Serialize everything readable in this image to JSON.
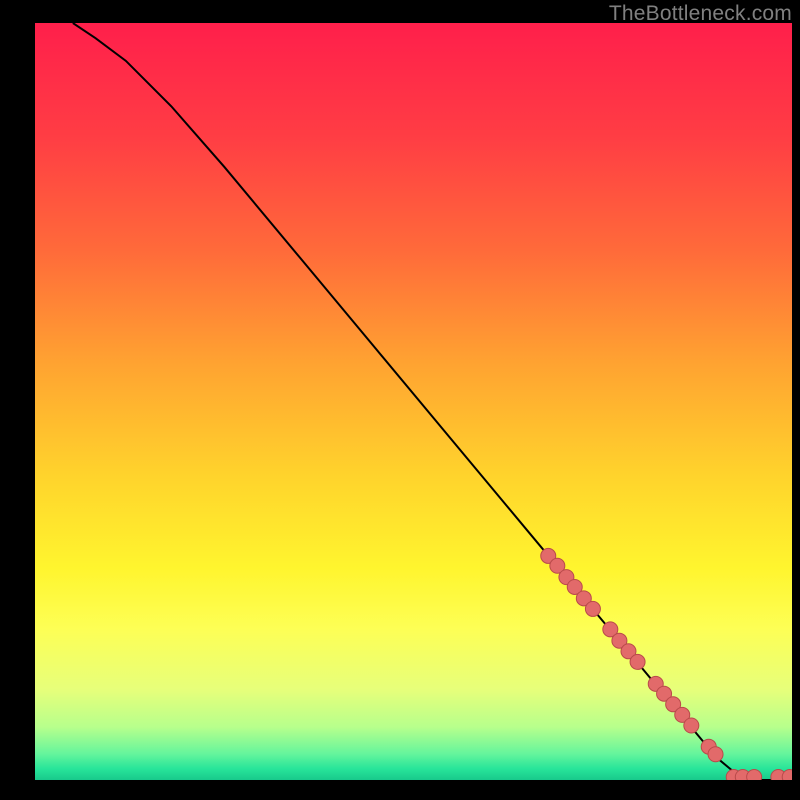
{
  "watermark": "TheBottleneck.com",
  "colors": {
    "marker_fill": "#e26a6a",
    "marker_stroke": "#b94a4a",
    "curve": "#000000",
    "black": "#000000"
  },
  "chart_data": {
    "type": "line",
    "title": "",
    "xlabel": "",
    "ylabel": "",
    "xlim": [
      0,
      100
    ],
    "ylim": [
      0,
      100
    ],
    "grid": false,
    "legend": false,
    "series": [
      {
        "name": "curve",
        "kind": "line",
        "x": [
          5,
          8,
          12,
          18,
          25,
          35,
          45,
          55,
          65,
          75,
          85,
          90,
          93,
          96,
          100
        ],
        "y": [
          100,
          98,
          95,
          89,
          81,
          69,
          57,
          45,
          33,
          21,
          9,
          3,
          0.5,
          0,
          0
        ]
      },
      {
        "name": "markers",
        "kind": "scatter",
        "x": [
          67.8,
          69.0,
          70.2,
          71.3,
          72.5,
          73.7,
          76.0,
          77.2,
          78.4,
          79.6,
          82.0,
          83.1,
          84.3,
          85.5,
          86.7,
          89.0,
          89.9,
          92.3,
          93.5,
          95.0,
          98.2,
          99.7
        ],
        "y": [
          29.6,
          28.3,
          26.8,
          25.5,
          24.0,
          22.6,
          19.9,
          18.4,
          17.0,
          15.6,
          12.7,
          11.4,
          10.0,
          8.6,
          7.2,
          4.4,
          3.4,
          0.4,
          0.4,
          0.4,
          0.4,
          0.4
        ]
      }
    ],
    "gradient_stops": [
      {
        "offset": 0.0,
        "color": "#ff1f4b"
      },
      {
        "offset": 0.15,
        "color": "#ff3d44"
      },
      {
        "offset": 0.3,
        "color": "#ff6a3a"
      },
      {
        "offset": 0.45,
        "color": "#ffa331"
      },
      {
        "offset": 0.6,
        "color": "#ffd42c"
      },
      {
        "offset": 0.72,
        "color": "#fff52e"
      },
      {
        "offset": 0.8,
        "color": "#fdff55"
      },
      {
        "offset": 0.88,
        "color": "#e7ff7a"
      },
      {
        "offset": 0.93,
        "color": "#b7ff8c"
      },
      {
        "offset": 0.965,
        "color": "#66f59c"
      },
      {
        "offset": 0.985,
        "color": "#28e59a"
      },
      {
        "offset": 1.0,
        "color": "#18c98b"
      }
    ]
  }
}
